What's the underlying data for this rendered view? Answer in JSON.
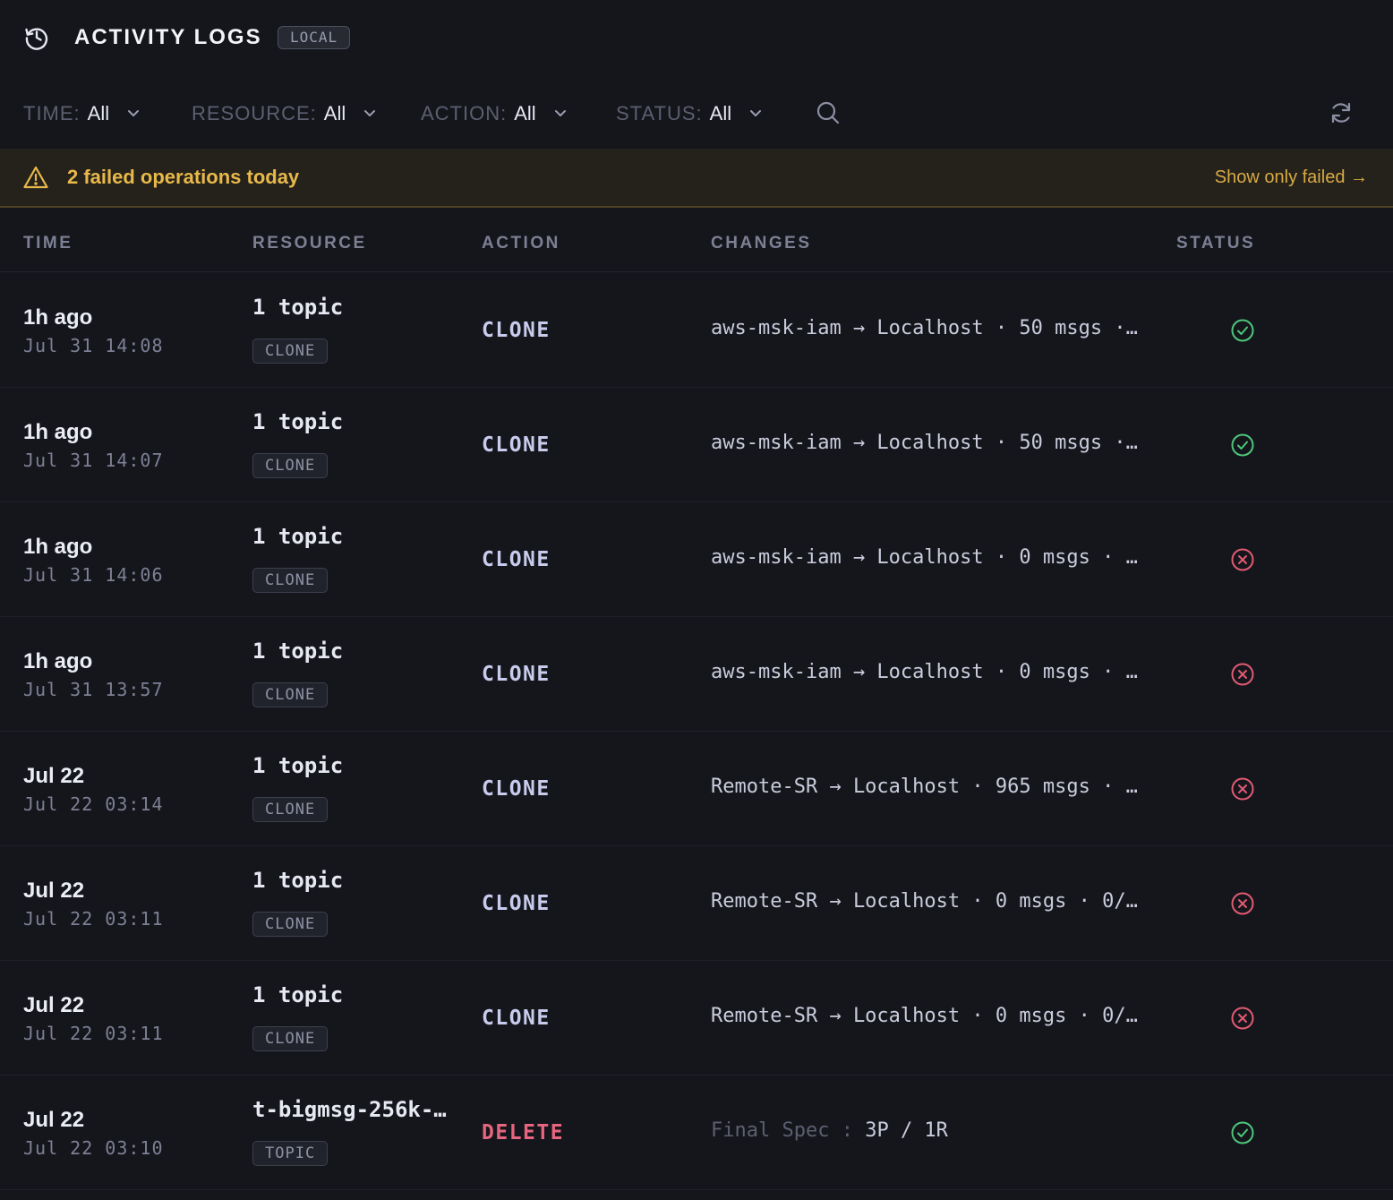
{
  "header": {
    "title": "ACTIVITY LOGS",
    "env_badge": "LOCAL"
  },
  "filters": [
    {
      "label": "TIME:",
      "value": "All"
    },
    {
      "label": "RESOURCE:",
      "value": "All"
    },
    {
      "label": "ACTION:",
      "value": "All"
    },
    {
      "label": "STATUS:",
      "value": "All"
    }
  ],
  "banner": {
    "text": "2 failed operations today",
    "link": "Show only failed →"
  },
  "columns": {
    "time": "TIME",
    "resource": "RESOURCE",
    "action": "ACTION",
    "changes": "CHANGES",
    "status": "STATUS"
  },
  "rows": [
    {
      "relative": "1h ago",
      "absolute": "Jul 31 14:08",
      "resource": "1 topic",
      "type": "CLONE",
      "action": "CLONE",
      "changes": "aws-msk-iam → Localhost · 50 msgs ·…",
      "status": "success"
    },
    {
      "relative": "1h ago",
      "absolute": "Jul 31 14:07",
      "resource": "1 topic",
      "type": "CLONE",
      "action": "CLONE",
      "changes": "aws-msk-iam → Localhost · 50 msgs ·…",
      "status": "success"
    },
    {
      "relative": "1h ago",
      "absolute": "Jul 31 14:06",
      "resource": "1 topic",
      "type": "CLONE",
      "action": "CLONE",
      "changes": "aws-msk-iam → Localhost · 0 msgs · …",
      "status": "failed"
    },
    {
      "relative": "1h ago",
      "absolute": "Jul 31 13:57",
      "resource": "1 topic",
      "type": "CLONE",
      "action": "CLONE",
      "changes": "aws-msk-iam → Localhost · 0 msgs · …",
      "status": "failed"
    },
    {
      "relative": "Jul 22",
      "absolute": "Jul 22 03:14",
      "resource": "1 topic",
      "type": "CLONE",
      "action": "CLONE",
      "changes": "Remote-SR → Localhost · 965 msgs · …",
      "status": "failed"
    },
    {
      "relative": "Jul 22",
      "absolute": "Jul 22 03:11",
      "resource": "1 topic",
      "type": "CLONE",
      "action": "CLONE",
      "changes": "Remote-SR → Localhost · 0 msgs · 0/…",
      "status": "failed"
    },
    {
      "relative": "Jul 22",
      "absolute": "Jul 22 03:11",
      "resource": "1 topic",
      "type": "CLONE",
      "action": "CLONE",
      "changes": "Remote-SR → Localhost · 0 msgs · 0/…",
      "status": "failed"
    },
    {
      "relative": "Jul 22",
      "absolute": "Jul 22 03:10",
      "resource": "t-bigmsg-256k-…",
      "type": "TOPIC",
      "action": "DELETE",
      "changes_label": "Final Spec :",
      "changes": "3P / 1R",
      "status": "success"
    }
  ],
  "colors": {
    "success": "#4cc77a",
    "failed": "#e05a72",
    "warning": "#e8b94a"
  },
  "icons": {
    "header": "history-icon",
    "filter": "chevron-down-icon",
    "search": "search-icon",
    "refresh": "refresh-icon",
    "banner": "warning-icon"
  }
}
